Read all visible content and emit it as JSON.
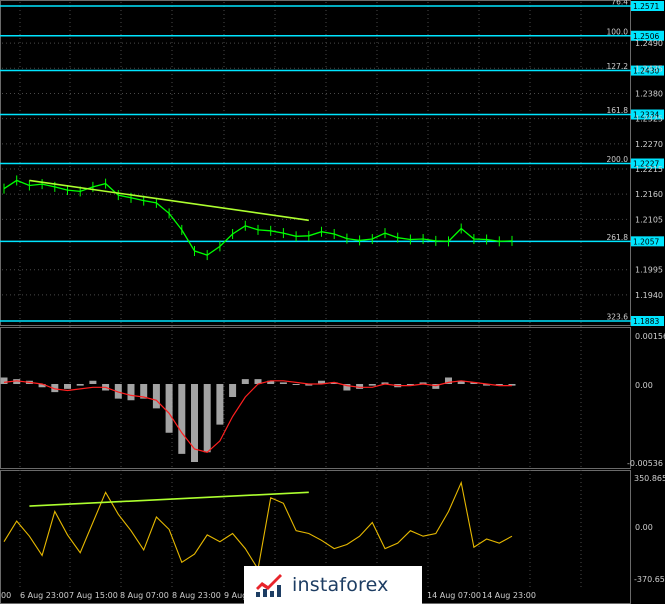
{
  "colors": {
    "background": "#000000",
    "price": "#00ff00",
    "levels": "#00e5ff",
    "trend": "#adff2f",
    "signal": "#ff2020",
    "histogram": "#c0c0c0",
    "cci": "#e6b800",
    "grid": "#5a5a5a"
  },
  "price_axis": {
    "labels": [
      "1.2490",
      "1.2435",
      "1.2380",
      "1.2325",
      "1.2270",
      "1.2215",
      "1.2160",
      "1.2105",
      "1.1995",
      "1.1940"
    ],
    "levels": [
      {
        "ratio": "76.4",
        "price": "1.2571"
      },
      {
        "ratio": "100.0",
        "price": "1.2506"
      },
      {
        "ratio": "127.2",
        "price": "1.2430"
      },
      {
        "ratio": "161.8",
        "price": "1.2334"
      },
      {
        "ratio": "200.0",
        "price": "1.2227"
      },
      {
        "ratio": "261.8",
        "price": "1.2057"
      },
      {
        "ratio": "323.6",
        "price": "1.1883"
      }
    ]
  },
  "macd_axis": {
    "top": "0.00156",
    "zero": "0.00",
    "bottom": "-0.00536"
  },
  "cci_axis": {
    "top": "350.8659",
    "zero": "0.00",
    "bottom": "-370.6573"
  },
  "time_axis": [
    "00",
    "6 Aug 23:00",
    "7 Aug 15:00",
    "8 Aug 07:00",
    "8 Aug 23:00",
    "9 Aug",
    "14 Aug 07:00",
    "14 Aug 23:00"
  ],
  "brand": {
    "name": "instaforex"
  },
  "chart_data": {
    "type": "line",
    "price_series": {
      "x": [
        0,
        1,
        2,
        3,
        4,
        5,
        6,
        7,
        8,
        9,
        10,
        11,
        12,
        13,
        14,
        15,
        16,
        17,
        18,
        19,
        20,
        21,
        22,
        23,
        24,
        25,
        26,
        27,
        28,
        29,
        30,
        31,
        32,
        33,
        34,
        35,
        36,
        37,
        38,
        39,
        40
      ],
      "values": [
        1.2172,
        1.219,
        1.2179,
        1.2182,
        1.2176,
        1.2169,
        1.2166,
        1.2176,
        1.2183,
        1.2158,
        1.2152,
        1.2146,
        1.2141,
        1.2118,
        1.2082,
        1.2036,
        1.2027,
        1.2046,
        1.2073,
        1.2091,
        1.2082,
        1.208,
        1.2075,
        1.2068,
        1.2069,
        1.2078,
        1.2073,
        1.2063,
        1.2059,
        1.2062,
        1.2075,
        1.2065,
        1.2061,
        1.2062,
        1.2058,
        1.2057,
        1.2085,
        1.2062,
        1.2061,
        1.2057,
        1.2058
      ]
    },
    "trendlines": [
      {
        "from": [
          2,
          1.219
        ],
        "to": [
          24,
          1.2103
        ]
      }
    ],
    "macd": {
      "histogram": [
        0.0004,
        0.0003,
        0.0002,
        -0.0002,
        -0.0005,
        -0.0003,
        -0.0001,
        0.0002,
        -0.0004,
        -0.0009,
        -0.001,
        -0.0009,
        -0.0015,
        -0.003,
        -0.0043,
        -0.0048,
        -0.0042,
        -0.0025,
        -0.0008,
        0.0003,
        0.0003,
        0.0002,
        0.0001,
        0.0,
        -0.0001,
        0.0002,
        0.0001,
        -0.0004,
        -0.0003,
        -0.0001,
        0.0001,
        -0.0002,
        0.0,
        0.0001,
        -0.0003,
        0.0004,
        0.0002,
        0.0001,
        -0.0001,
        -0.0001,
        -0.0001
      ],
      "signal": [
        0.0001,
        0.0002,
        0.0001,
        0.0,
        -0.0003,
        -0.0004,
        -0.0003,
        -0.0002,
        -0.0002,
        -0.0005,
        -0.0007,
        -0.0008,
        -0.001,
        -0.0018,
        -0.003,
        -0.004,
        -0.0042,
        -0.0035,
        -0.002,
        -0.0008,
        0.0,
        0.0002,
        0.0002,
        0.0001,
        0.0,
        0.0,
        0.0001,
        -0.0001,
        -0.0002,
        -0.0002,
        0.0,
        -0.0001,
        -0.0001,
        0.0,
        -0.0001,
        0.0001,
        0.0002,
        0.0001,
        0.0,
        -0.0001,
        -0.0001
      ]
    },
    "cci": {
      "values": [
        -100,
        50,
        -60,
        -200,
        120,
        -50,
        -180,
        40,
        260,
        100,
        -20,
        -160,
        80,
        -10,
        -250,
        -190,
        -50,
        -100,
        -40,
        -150,
        -300,
        220,
        180,
        -20,
        -40,
        -90,
        -150,
        -120,
        -60,
        40,
        -150,
        -110,
        -20,
        -60,
        -40,
        120,
        330,
        -140,
        -80,
        -110,
        -60
      ],
      "trendline": {
        "from": [
          2,
          160
        ],
        "to": [
          24,
          260
        ]
      }
    }
  }
}
